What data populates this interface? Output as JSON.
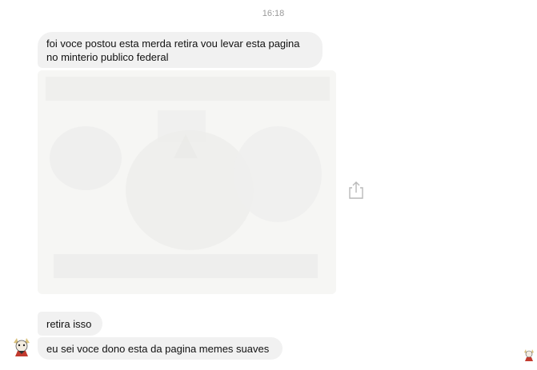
{
  "conversation": {
    "timestamp": "16:18",
    "messages": [
      {
        "type": "text",
        "lines": [
          "foi voce postou esta merda retira vou levar esta pagina",
          "no minterio publico federal"
        ]
      },
      {
        "type": "image",
        "icon": "share-icon"
      },
      {
        "type": "text",
        "text": "retira isso"
      },
      {
        "type": "text",
        "text": "eu sei voce dono esta da pagina memes suaves"
      }
    ]
  },
  "icons": {
    "avatar": "avatar-icon",
    "share": "share-icon",
    "seen": "seen-avatar-icon"
  },
  "colors": {
    "bubble": "#f1f1f1",
    "text": "#111111",
    "timestamp": "#9a9a9a",
    "image_bg": "#f6f6f4"
  }
}
